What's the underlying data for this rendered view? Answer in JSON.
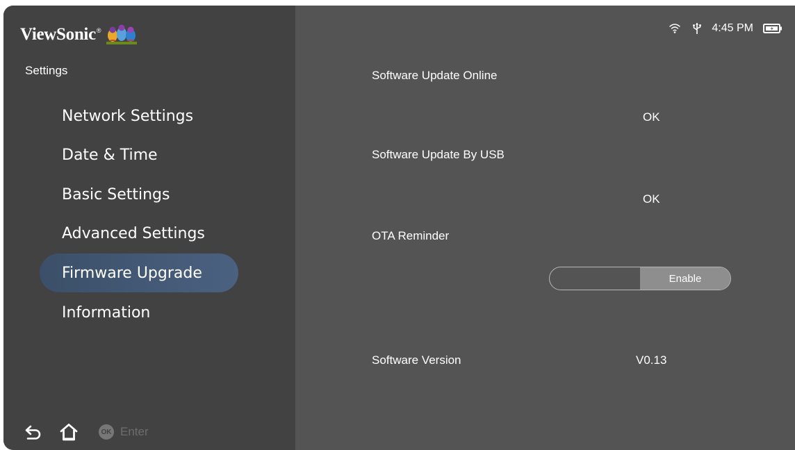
{
  "brand": {
    "name": "ViewSonic",
    "reg": "®"
  },
  "sidebar": {
    "title": "Settings",
    "items": [
      {
        "label": "Network Settings"
      },
      {
        "label": "Date & Time"
      },
      {
        "label": "Basic Settings"
      },
      {
        "label": "Advanced Settings"
      },
      {
        "label": "Firmware Upgrade",
        "selected": true
      },
      {
        "label": "Information"
      }
    ]
  },
  "bottom_bar": {
    "icons": [
      "back-icon",
      "home-icon"
    ],
    "ok_badge": "OK",
    "enter_label": "Enter"
  },
  "status_bar": {
    "icons": [
      "wifi-icon",
      "usb-icon",
      "battery-icon"
    ],
    "time": "4:45 PM"
  },
  "main": {
    "update_online": {
      "label": "Software Update Online",
      "action": "OK"
    },
    "update_usb": {
      "label": "Software Update By USB",
      "action": "OK"
    },
    "ota_reminder": {
      "label": "OTA Reminder",
      "toggle_value": "Enable"
    },
    "software_version": {
      "label": "Software Version",
      "value": "V0.13"
    }
  },
  "colors": {
    "sidebar_bg": "#424242",
    "main_bg": "#545454",
    "selected_item": "#435a77",
    "toggle_on": "#8e8e8e"
  }
}
